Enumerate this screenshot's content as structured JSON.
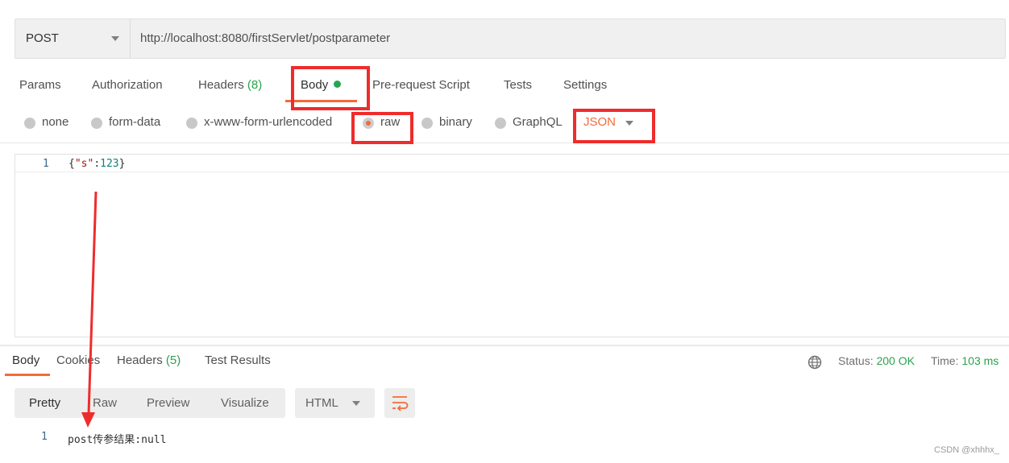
{
  "request": {
    "method": "POST",
    "url": "http://localhost:8080/firstServlet/postparameter"
  },
  "request_tabs": {
    "params": "Params",
    "authorization": "Authorization",
    "headers": "Headers",
    "headers_count": "(8)",
    "body": "Body",
    "pre_request": "Pre-request Script",
    "tests": "Tests",
    "settings": "Settings"
  },
  "body_modes": {
    "none": "none",
    "form_data": "form-data",
    "urlencoded": "x-www-form-urlencoded",
    "raw": "raw",
    "binary": "binary",
    "graphql": "GraphQL",
    "language": "JSON",
    "selected": "raw"
  },
  "editor": {
    "line_number": "1",
    "brace_open": "{",
    "key": "\"s\"",
    "colon": ":",
    "value": "123",
    "brace_close": "}"
  },
  "response_tabs": {
    "body": "Body",
    "cookies": "Cookies",
    "headers": "Headers",
    "headers_count": "(5)",
    "test_results": "Test Results"
  },
  "response_status": {
    "status_label": "Status:",
    "status_value": "200 OK",
    "time_label": "Time:",
    "time_value": "103 ms"
  },
  "response_view": {
    "pretty": "Pretty",
    "raw": "Raw",
    "preview": "Preview",
    "visualize": "Visualize",
    "format": "HTML"
  },
  "response_body": {
    "line_number": "1",
    "text": "post传参结果:null"
  },
  "watermark": "CSDN @xhhhx_",
  "colors": {
    "accent": "#f26b3a",
    "success": "#2aa24d",
    "annotation": "#ef2c2c"
  }
}
